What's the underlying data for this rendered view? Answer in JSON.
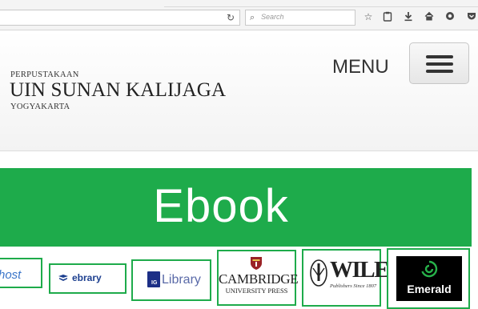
{
  "browser": {
    "search_placeholder": "Search",
    "icons": [
      "reload-icon",
      "search-icon",
      "star-icon",
      "clipboard-icon",
      "download-icon",
      "home-icon",
      "chat-icon",
      "pocket-icon"
    ]
  },
  "header": {
    "logo": {
      "line1": "PERPUSTAKAAN",
      "line2": "UIN SUNAN KALIJAGA",
      "line3": "YOGYAKARTA"
    },
    "menu_label": "MENU"
  },
  "banner": {
    "title": "Ebook"
  },
  "providers": {
    "ebscohost": "host",
    "ebrary": "ebrary",
    "iglibrary_badge": "IG",
    "iglibrary": "Library",
    "cambridge": "CAMBRIDGE",
    "cambridge_sub": "UNIVERSITY PRESS",
    "wiley": "WILEY",
    "wiley_sub": "Publishers Since 1807",
    "emerald": "Emerald"
  },
  "colors": {
    "accent_green": "#1eab4b",
    "toolbar_bg": "#f4f4f4"
  }
}
